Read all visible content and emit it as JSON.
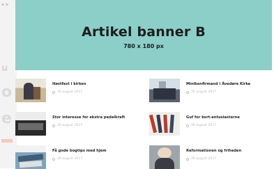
{
  "banner": {
    "title": "Artikel banner B",
    "size_label": "780 x 180 px",
    "background_color": "#8ccfc8"
  },
  "articles": [
    {
      "title": "Høstfest i kirken",
      "date": "26 august 2017",
      "thumb_icon": "photo-thumbnail"
    },
    {
      "title": "Minikonfirmand i Ävedøre Kirke",
      "date": "26 august 2017",
      "thumb_icon": "photo-thumbnail"
    },
    {
      "title": "Stor interesse for ekstra pedelkraft",
      "date": "26 august 2017",
      "thumb_icon": "photo-thumbnail"
    },
    {
      "title": "Guf for kort-entusiasterne",
      "date": "26 august 2017",
      "thumb_icon": "photo-thumbnail"
    },
    {
      "title": "Få gode bogtips med hjem",
      "date": "26 august 2017",
      "thumb_icon": "photo-thumbnail"
    },
    {
      "title": "Reformationen og friheden",
      "date": "26 august 2017",
      "thumb_icon": "photo-thumbnail"
    }
  ],
  "date_icon": "clock-icon"
}
